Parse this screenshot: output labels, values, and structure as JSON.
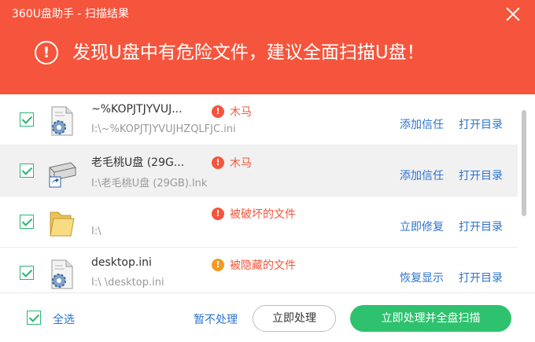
{
  "window": {
    "title": "360U盘助手 - 扫描结果"
  },
  "banner": {
    "headline": "发现U盘中有危险文件，建议全面扫描U盘！"
  },
  "files": [
    {
      "name": "~%KOPJTJYVUJ...",
      "path": "I:\\~%KOPJTJYVUJHZQLFJC.ini",
      "risk": "木马",
      "action1": "添加信任",
      "action2": "打开目录",
      "icon": "settings-file-icon"
    },
    {
      "name": "老毛桃U盘 (29G...",
      "path": "I:\\老毛桃U盘 (29GB).lnk",
      "risk": "木马",
      "action1": "添加信任",
      "action2": "打开目录",
      "icon": "drive-shortcut-icon"
    },
    {
      "name": "",
      "path": "I:\\",
      "risk": "被破坏的文件",
      "action1": "立即修复",
      "action2": "打开目录",
      "icon": "folder-icon"
    },
    {
      "name": "desktop.ini",
      "path": "I:\\ \\desktop.ini",
      "risk": "被隐藏的文件",
      "action1": "恢复显示",
      "action2": "打开目录",
      "icon": "settings-file-icon"
    }
  ],
  "footer": {
    "select_all": "全选",
    "skip": "暂不处理",
    "handle_now": "立即处理",
    "handle_and_scan": "立即处理并全盘扫描"
  },
  "colors": {
    "header": "#f5553c",
    "link": "#2b73d1",
    "checkbox": "#2bb673",
    "primary_button": "#2ec26e",
    "warning_orange": "#f59a23"
  }
}
